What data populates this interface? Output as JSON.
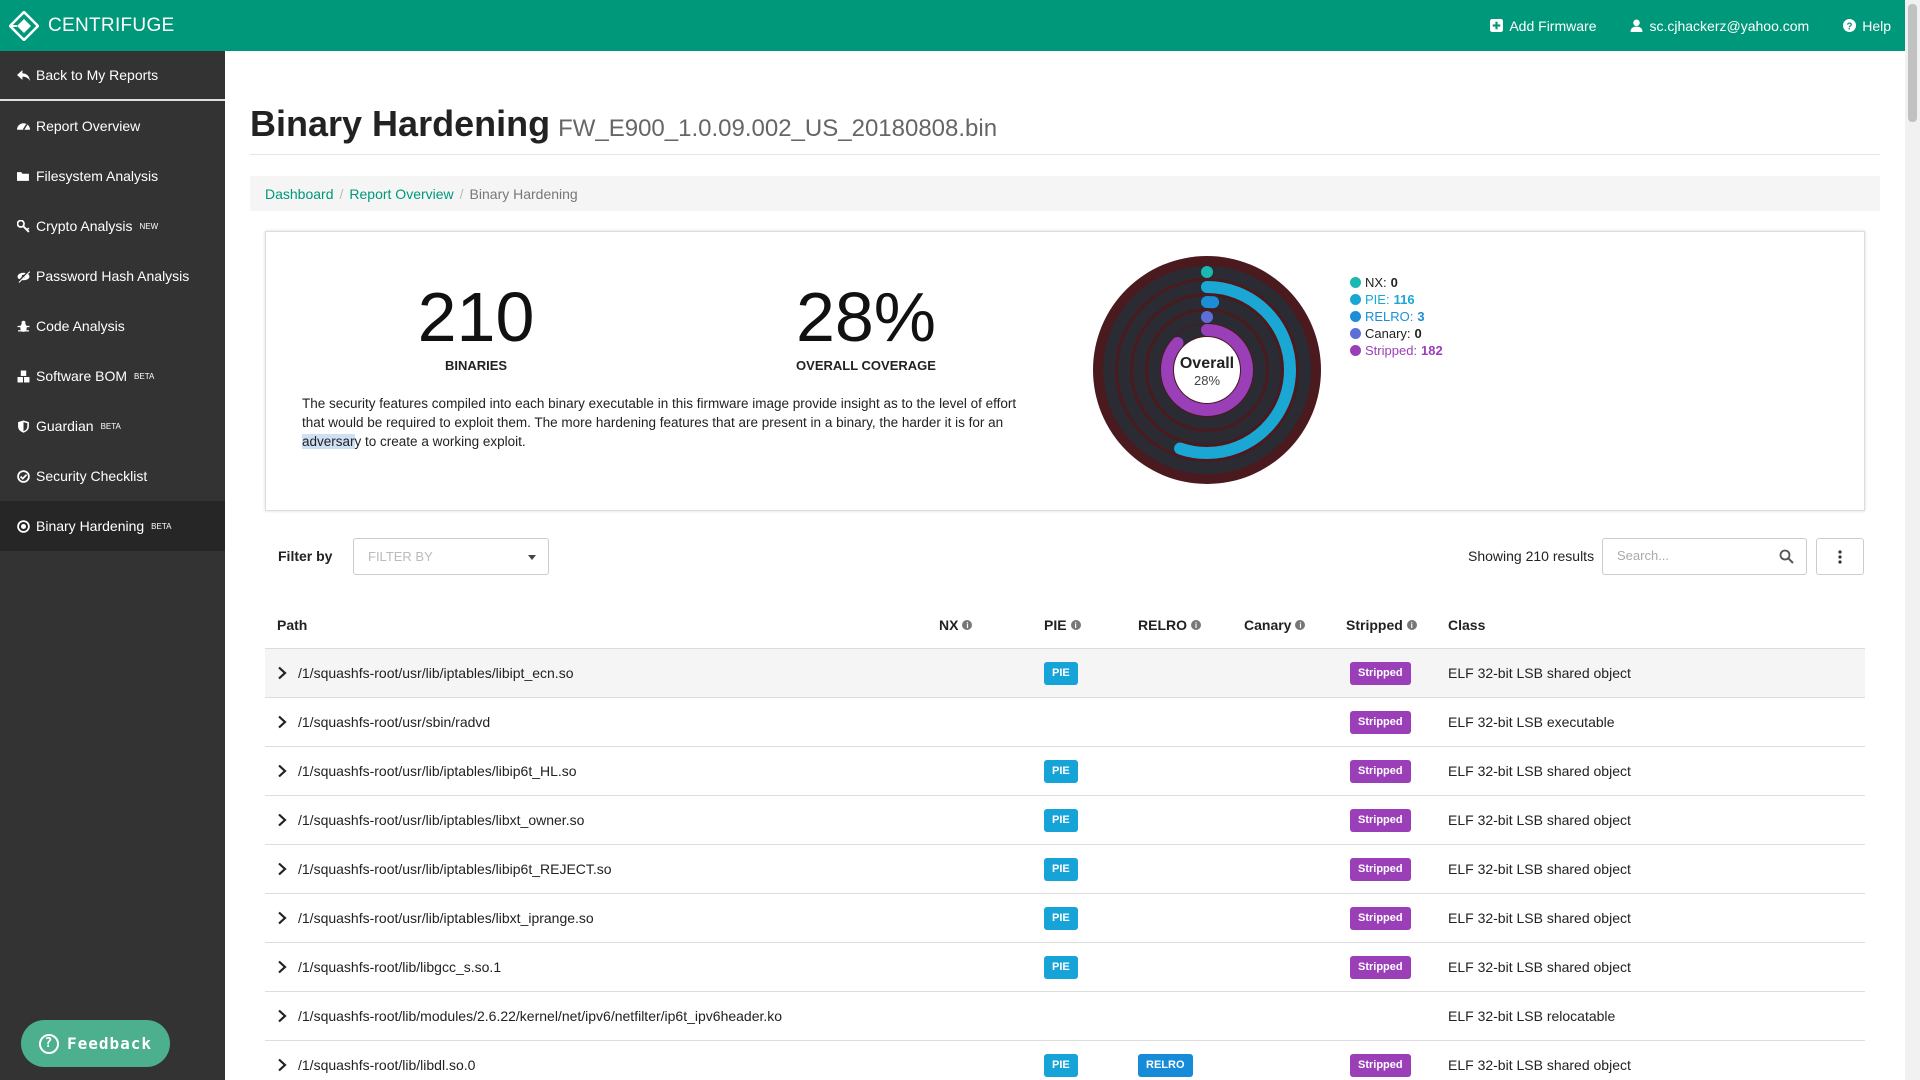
{
  "topbar": {
    "brand": "CENTRIFUGE",
    "add_firmware": "Add Firmware",
    "user_email": "sc.cjhackerz@yahoo.com",
    "help": "Help"
  },
  "sidebar": {
    "back": "Back to My Reports",
    "items": [
      {
        "label": "Report Overview",
        "tag": "",
        "icon": "dashboard-icon"
      },
      {
        "label": "Filesystem Analysis",
        "tag": "",
        "icon": "folder-icon"
      },
      {
        "label": "Crypto Analysis",
        "tag": "NEW",
        "icon": "key-icon"
      },
      {
        "label": "Password Hash Analysis",
        "tag": "",
        "icon": "eye-slash-icon"
      },
      {
        "label": "Code Analysis",
        "tag": "",
        "icon": "bug-icon"
      },
      {
        "label": "Software BOM",
        "tag": "BETA",
        "icon": "cubes-icon"
      },
      {
        "label": "Guardian",
        "tag": "BETA",
        "icon": "shield-icon"
      },
      {
        "label": "Security Checklist",
        "tag": "",
        "icon": "check-circle-icon"
      },
      {
        "label": "Binary Hardening",
        "tag": "BETA",
        "icon": "dot-circle-icon"
      }
    ],
    "feedback": "Feedback"
  },
  "page": {
    "title": "Binary Hardening",
    "firmware": "FW_E900_1.0.09.002_US_20180808.bin"
  },
  "breadcrumb": {
    "dashboard": "Dashboard",
    "overview": "Report Overview",
    "current": "Binary Hardening"
  },
  "summary": {
    "binaries_count": "210",
    "binaries_label": "BINARIES",
    "coverage_value": "28%",
    "coverage_label": "OVERALL COVERAGE",
    "description_before": "The security features compiled into each binary executable in this firmware image provide insight as to the level of effort that would be required to exploit them. The more hardening features that are present in a binary, the harder it is for an ",
    "description_highlight": "adversar",
    "description_after": "y to create a working exploit."
  },
  "donut": {
    "center_title": "Overall",
    "center_value": "28%",
    "total": 210,
    "rings": [
      {
        "name": "NX",
        "value": 0,
        "color": "#1ab8b0"
      },
      {
        "name": "PIE",
        "value": 116,
        "color": "#1aa7d4"
      },
      {
        "name": "RELRO",
        "value": 3,
        "color": "#1c8ed6"
      },
      {
        "name": "Canary",
        "value": 0,
        "color": "#5c6fd6"
      },
      {
        "name": "Stripped",
        "value": 182,
        "color": "#9b3fb8"
      }
    ],
    "track_color": "#4a1a1f"
  },
  "legend": [
    {
      "label": "NX:",
      "value": "0",
      "color": "#1ab8b0",
      "text_color": "#222"
    },
    {
      "label": "PIE:",
      "value": "116",
      "color": "#1aa7d4",
      "text_color": "#1aa7d4"
    },
    {
      "label": "RELRO:",
      "value": "3",
      "color": "#1c8ed6",
      "text_color": "#1c8ed6"
    },
    {
      "label": "Canary:",
      "value": "0",
      "color": "#5c6fd6",
      "text_color": "#222"
    },
    {
      "label": "Stripped:",
      "value": "182",
      "color": "#9b3fb8",
      "text_color": "#9b3fb8"
    }
  ],
  "filter": {
    "label": "Filter by",
    "placeholder": "FILTER BY",
    "results": "Showing 210 results",
    "search_placeholder": "Search..."
  },
  "table": {
    "headers": {
      "path": "Path",
      "nx": "NX",
      "pie": "PIE",
      "relro": "RELRO",
      "canary": "Canary",
      "stripped": "Stripped",
      "class": "Class"
    },
    "rows": [
      {
        "path": "/1/squashfs-root/usr/lib/iptables/libipt_ecn.so",
        "pie": "PIE",
        "relro": "",
        "stripped": "Stripped",
        "class": "ELF 32-bit LSB shared object"
      },
      {
        "path": "/1/squashfs-root/usr/sbin/radvd",
        "pie": "",
        "relro": "",
        "stripped": "Stripped",
        "class": "ELF 32-bit LSB executable"
      },
      {
        "path": "/1/squashfs-root/usr/lib/iptables/libip6t_HL.so",
        "pie": "PIE",
        "relro": "",
        "stripped": "Stripped",
        "class": "ELF 32-bit LSB shared object"
      },
      {
        "path": "/1/squashfs-root/usr/lib/iptables/libxt_owner.so",
        "pie": "PIE",
        "relro": "",
        "stripped": "Stripped",
        "class": "ELF 32-bit LSB shared object"
      },
      {
        "path": "/1/squashfs-root/usr/lib/iptables/libip6t_REJECT.so",
        "pie": "PIE",
        "relro": "",
        "stripped": "Stripped",
        "class": "ELF 32-bit LSB shared object"
      },
      {
        "path": "/1/squashfs-root/usr/lib/iptables/libxt_iprange.so",
        "pie": "PIE",
        "relro": "",
        "stripped": "Stripped",
        "class": "ELF 32-bit LSB shared object"
      },
      {
        "path": "/1/squashfs-root/lib/libgcc_s.so.1",
        "pie": "PIE",
        "relro": "",
        "stripped": "Stripped",
        "class": "ELF 32-bit LSB shared object"
      },
      {
        "path": "/1/squashfs-root/lib/modules/2.6.22/kernel/net/ipv6/netfilter/ip6t_ipv6header.ko",
        "pie": "",
        "relro": "",
        "stripped": "",
        "class": "ELF 32-bit LSB relocatable"
      },
      {
        "path": "/1/squashfs-root/lib/libdl.so.0",
        "pie": "PIE",
        "relro": "RELRO",
        "stripped": "Stripped",
        "class": "ELF 32-bit LSB shared object"
      }
    ]
  }
}
